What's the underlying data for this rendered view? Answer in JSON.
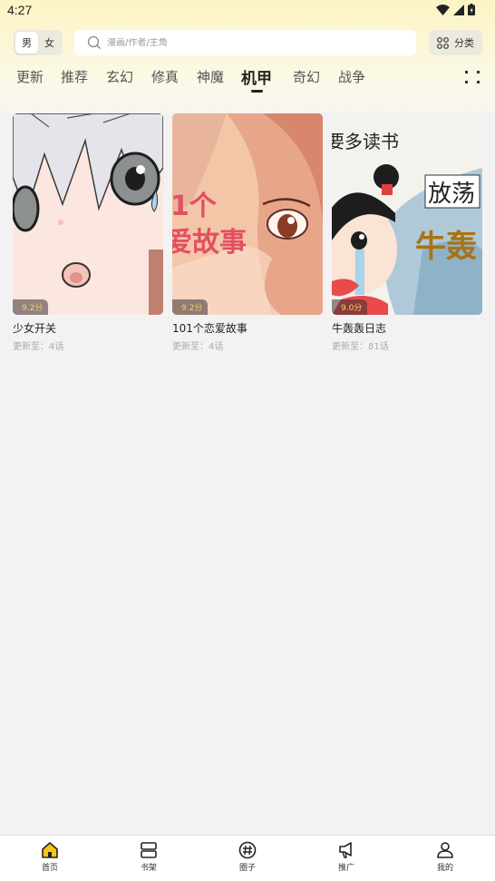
{
  "status_bar": {
    "time": "4:27"
  },
  "header": {
    "gender_male": "男",
    "gender_female": "女",
    "search_placeholder": "漫画/作者/主角",
    "category_label": "分类"
  },
  "tabs": [
    {
      "label": "更新"
    },
    {
      "label": "推荐"
    },
    {
      "label": "玄幻"
    },
    {
      "label": "修真"
    },
    {
      "label": "神魔"
    },
    {
      "label": "机甲"
    },
    {
      "label": "奇幻"
    },
    {
      "label": "战争"
    }
  ],
  "active_tab": "机甲",
  "comics": [
    {
      "title": "少女开关",
      "update": "更新至：4话",
      "rating": "9.2分"
    },
    {
      "title": "101个恋爱故事",
      "update": "更新至：4话",
      "rating": "9.2分",
      "cover_text": [
        "1个",
        "爱故事"
      ]
    },
    {
      "title": "牛轰轰日志",
      "update": "更新至：81话",
      "rating": "9.0分",
      "cover_text": [
        "要多读书",
        "放荡",
        "牛轰"
      ]
    }
  ],
  "bottom_nav": [
    {
      "label": "首页",
      "icon": "home-icon",
      "active": true
    },
    {
      "label": "书架",
      "icon": "bookshelf-icon"
    },
    {
      "label": "圈子",
      "icon": "hashtag-icon"
    },
    {
      "label": "推广",
      "icon": "megaphone-icon"
    },
    {
      "label": "我的",
      "icon": "user-icon"
    }
  ],
  "colors": {
    "accent": "#f5c518",
    "rating_text": "#f3d35a",
    "header_bg": "#fdf4c4"
  }
}
